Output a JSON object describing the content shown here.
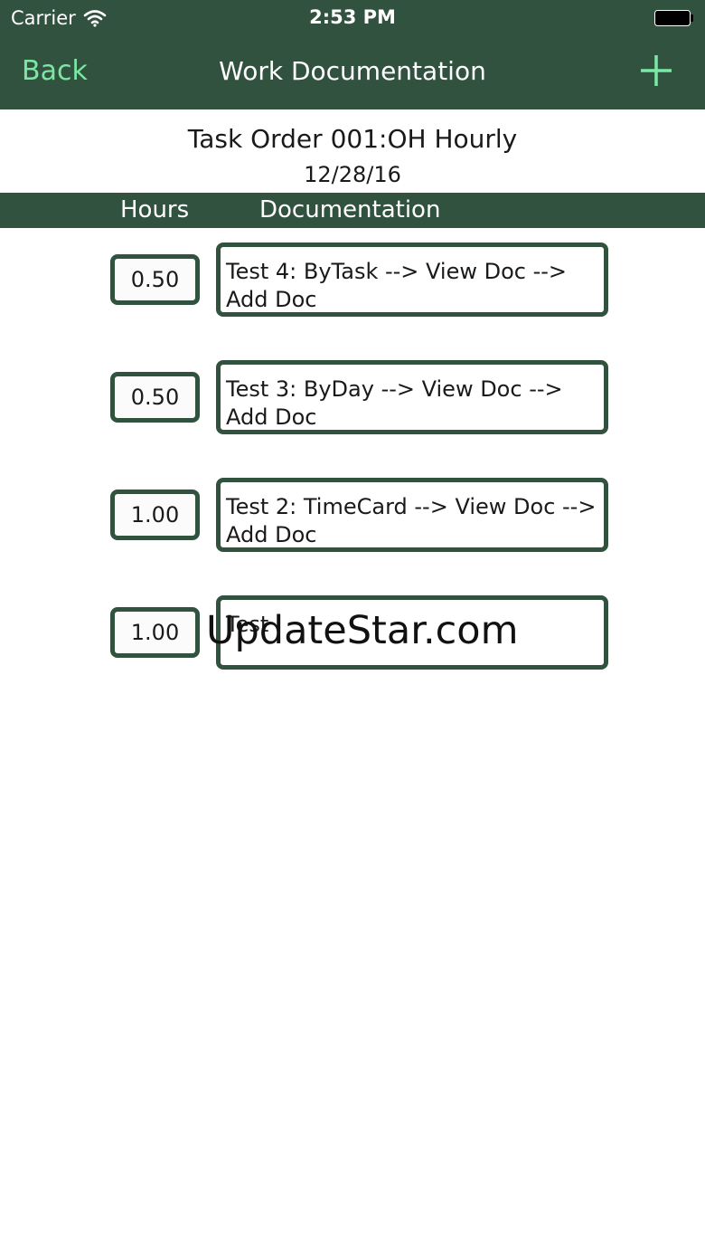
{
  "status_bar": {
    "carrier": "Carrier",
    "time": "2:53 PM"
  },
  "nav": {
    "back_label": "Back",
    "title": "Work Documentation",
    "add_icon": "plus-icon"
  },
  "task": {
    "title": "Task Order 001:OH Hourly",
    "date": "12/28/16"
  },
  "columns": {
    "hours": "Hours",
    "documentation": "Documentation"
  },
  "rows": [
    {
      "hours": "0.50",
      "doc": "Test 4: ByTask --> View Doc --> Add Doc"
    },
    {
      "hours": "0.50",
      "doc": "Test 3: ByDay --> View Doc --> Add Doc"
    },
    {
      "hours": "1.00",
      "doc": "Test 2: TimeCard --> View Doc --> Add Doc"
    },
    {
      "hours": "1.00",
      "doc": "Test"
    }
  ],
  "watermark": "UpdateStar.com",
  "colors": {
    "bar_green": "#325240",
    "accent_green": "#7ae8a4"
  }
}
